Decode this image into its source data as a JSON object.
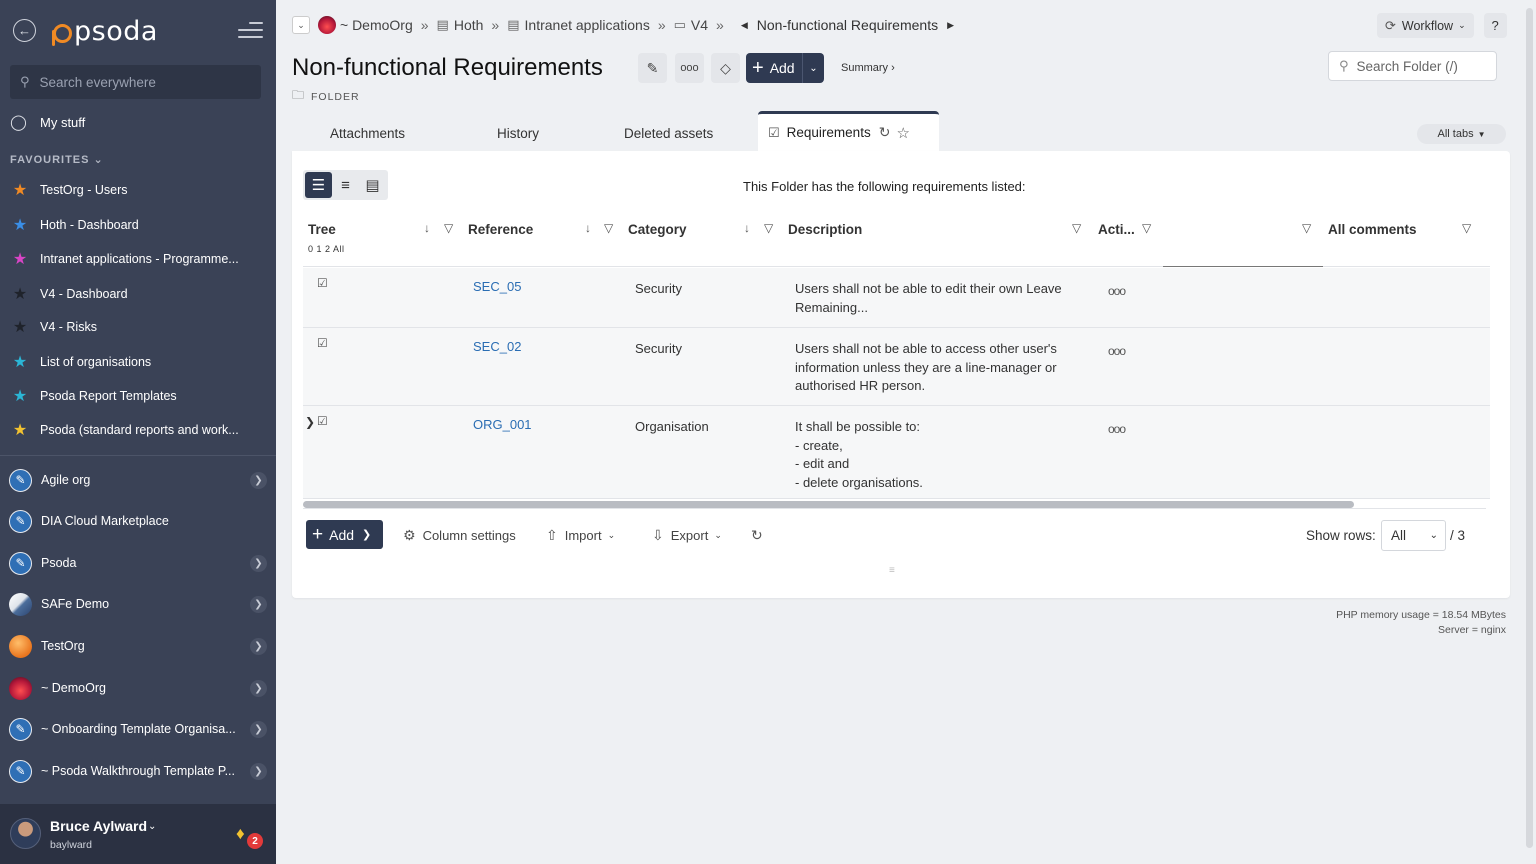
{
  "sidebar": {
    "logo_text": "psoda",
    "search_placeholder": "Search everywhere",
    "my_stuff": "My stuff",
    "favourites_header": "FAVOURITES",
    "favourites": [
      {
        "label": "TestOrg - Users",
        "color": "#f08a24"
      },
      {
        "label": "Hoth - Dashboard",
        "color": "#3a8ee6"
      },
      {
        "label": "Intranet applications - Programme...",
        "color": "#d845c6"
      },
      {
        "label": "V4 - Dashboard",
        "color": "#2b2f38"
      },
      {
        "label": "V4 - Risks",
        "color": "#2b2f38"
      },
      {
        "label": "List of organisations",
        "color": "#2bb6d6"
      },
      {
        "label": "Psoda Report Templates",
        "color": "#2bb6d6"
      },
      {
        "label": "Psoda (standard reports and work...",
        "color": "#f2c230"
      }
    ],
    "orgs": [
      {
        "label": "Agile org",
        "avatar": "pen",
        "chevron": true
      },
      {
        "label": "DIA Cloud Marketplace",
        "avatar": "pen",
        "chevron": false
      },
      {
        "label": "Psoda",
        "avatar": "pen",
        "chevron": true
      },
      {
        "label": "SAFe Demo",
        "avatar": "safe",
        "chevron": true
      },
      {
        "label": "TestOrg",
        "avatar": "orange",
        "chevron": true
      },
      {
        "label": "~ DemoOrg",
        "avatar": "demo",
        "chevron": true
      },
      {
        "label": "~ Onboarding Template Organisa...",
        "avatar": "pen",
        "chevron": true
      },
      {
        "label": "~ Psoda Walkthrough Template P...",
        "avatar": "pen",
        "chevron": true
      }
    ],
    "user": {
      "name": "Bruce Aylward",
      "username": "baylward",
      "notifications": "2"
    }
  },
  "breadcrumb": {
    "items": [
      "~ DemoOrg",
      "Hoth",
      "Intranet applications",
      "V4"
    ],
    "current": "Non-functional Requirements"
  },
  "header": {
    "workflow_label": "Workflow",
    "help_label": "?",
    "title": "Non-functional Requirements",
    "subtitle": "FOLDER",
    "add_label": "Add",
    "summary_label": "Summary ›",
    "search_placeholder": "Search Folder (/)"
  },
  "tabs": {
    "items": [
      "Attachments",
      "History",
      "Deleted assets"
    ],
    "active": "Requirements",
    "all_tabs": "All tabs"
  },
  "table": {
    "caption": "This Folder has the following requirements listed:",
    "tree_levels": "0 1 2 All",
    "columns": {
      "tree": "Tree",
      "reference": "Reference",
      "category": "Category",
      "description": "Description",
      "actions": "Acti...",
      "comments": "All comments"
    },
    "rows": [
      {
        "ref": "SEC_05",
        "category": "Security",
        "description": [
          "Users shall not be able to edit their own Leave",
          "Remaining..."
        ],
        "actions": "ooo"
      },
      {
        "ref": "SEC_02",
        "category": "Security",
        "description": [
          "Users shall not be able to access other user's",
          "information unless they are a line-manager or",
          "authorised HR person."
        ],
        "actions": "ooo"
      },
      {
        "ref": "ORG_001",
        "category": "Organisation",
        "description": [
          "It shall be possible to:",
          "- create,",
          "- edit and",
          "- delete organisations."
        ],
        "actions": "ooo"
      }
    ],
    "footer": {
      "add": "Add",
      "column_settings": "Column settings",
      "import": "Import",
      "export": "Export",
      "show_rows_label": "Show rows:",
      "show_rows_value": "All",
      "total": "/ 3"
    }
  },
  "server": {
    "memory": "PHP memory usage = 18.54 MBytes",
    "server": "Server = nginx"
  }
}
